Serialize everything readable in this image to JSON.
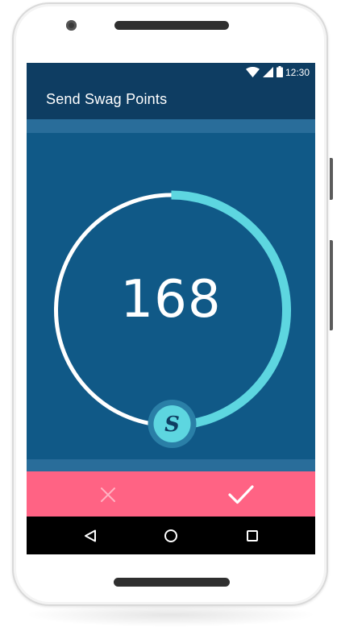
{
  "status_bar": {
    "time": "12:30",
    "icons": [
      "wifi-icon",
      "cellular-signal-icon",
      "battery-icon"
    ]
  },
  "app_bar": {
    "title": "Send Swag Points"
  },
  "points_dial": {
    "value": "168",
    "progress_fraction": 0.5,
    "knob_letter": "S",
    "colors": {
      "track": "#ffffff",
      "progress": "#5dd6e0",
      "knob_fill": "#5dd6e0",
      "knob_letter": "#0e3d62"
    }
  },
  "actions": {
    "cancel_icon": "close-icon",
    "confirm_icon": "check-icon"
  },
  "nav_bar": {
    "icons": [
      "back-icon",
      "home-icon",
      "recents-icon"
    ]
  },
  "colors": {
    "status_bar": "#0e3d62",
    "app_bar": "#0e3d62",
    "content": "#105987",
    "stripe": "#296d9a",
    "action_bar": "#ff6384",
    "nav_bar": "#000000"
  }
}
